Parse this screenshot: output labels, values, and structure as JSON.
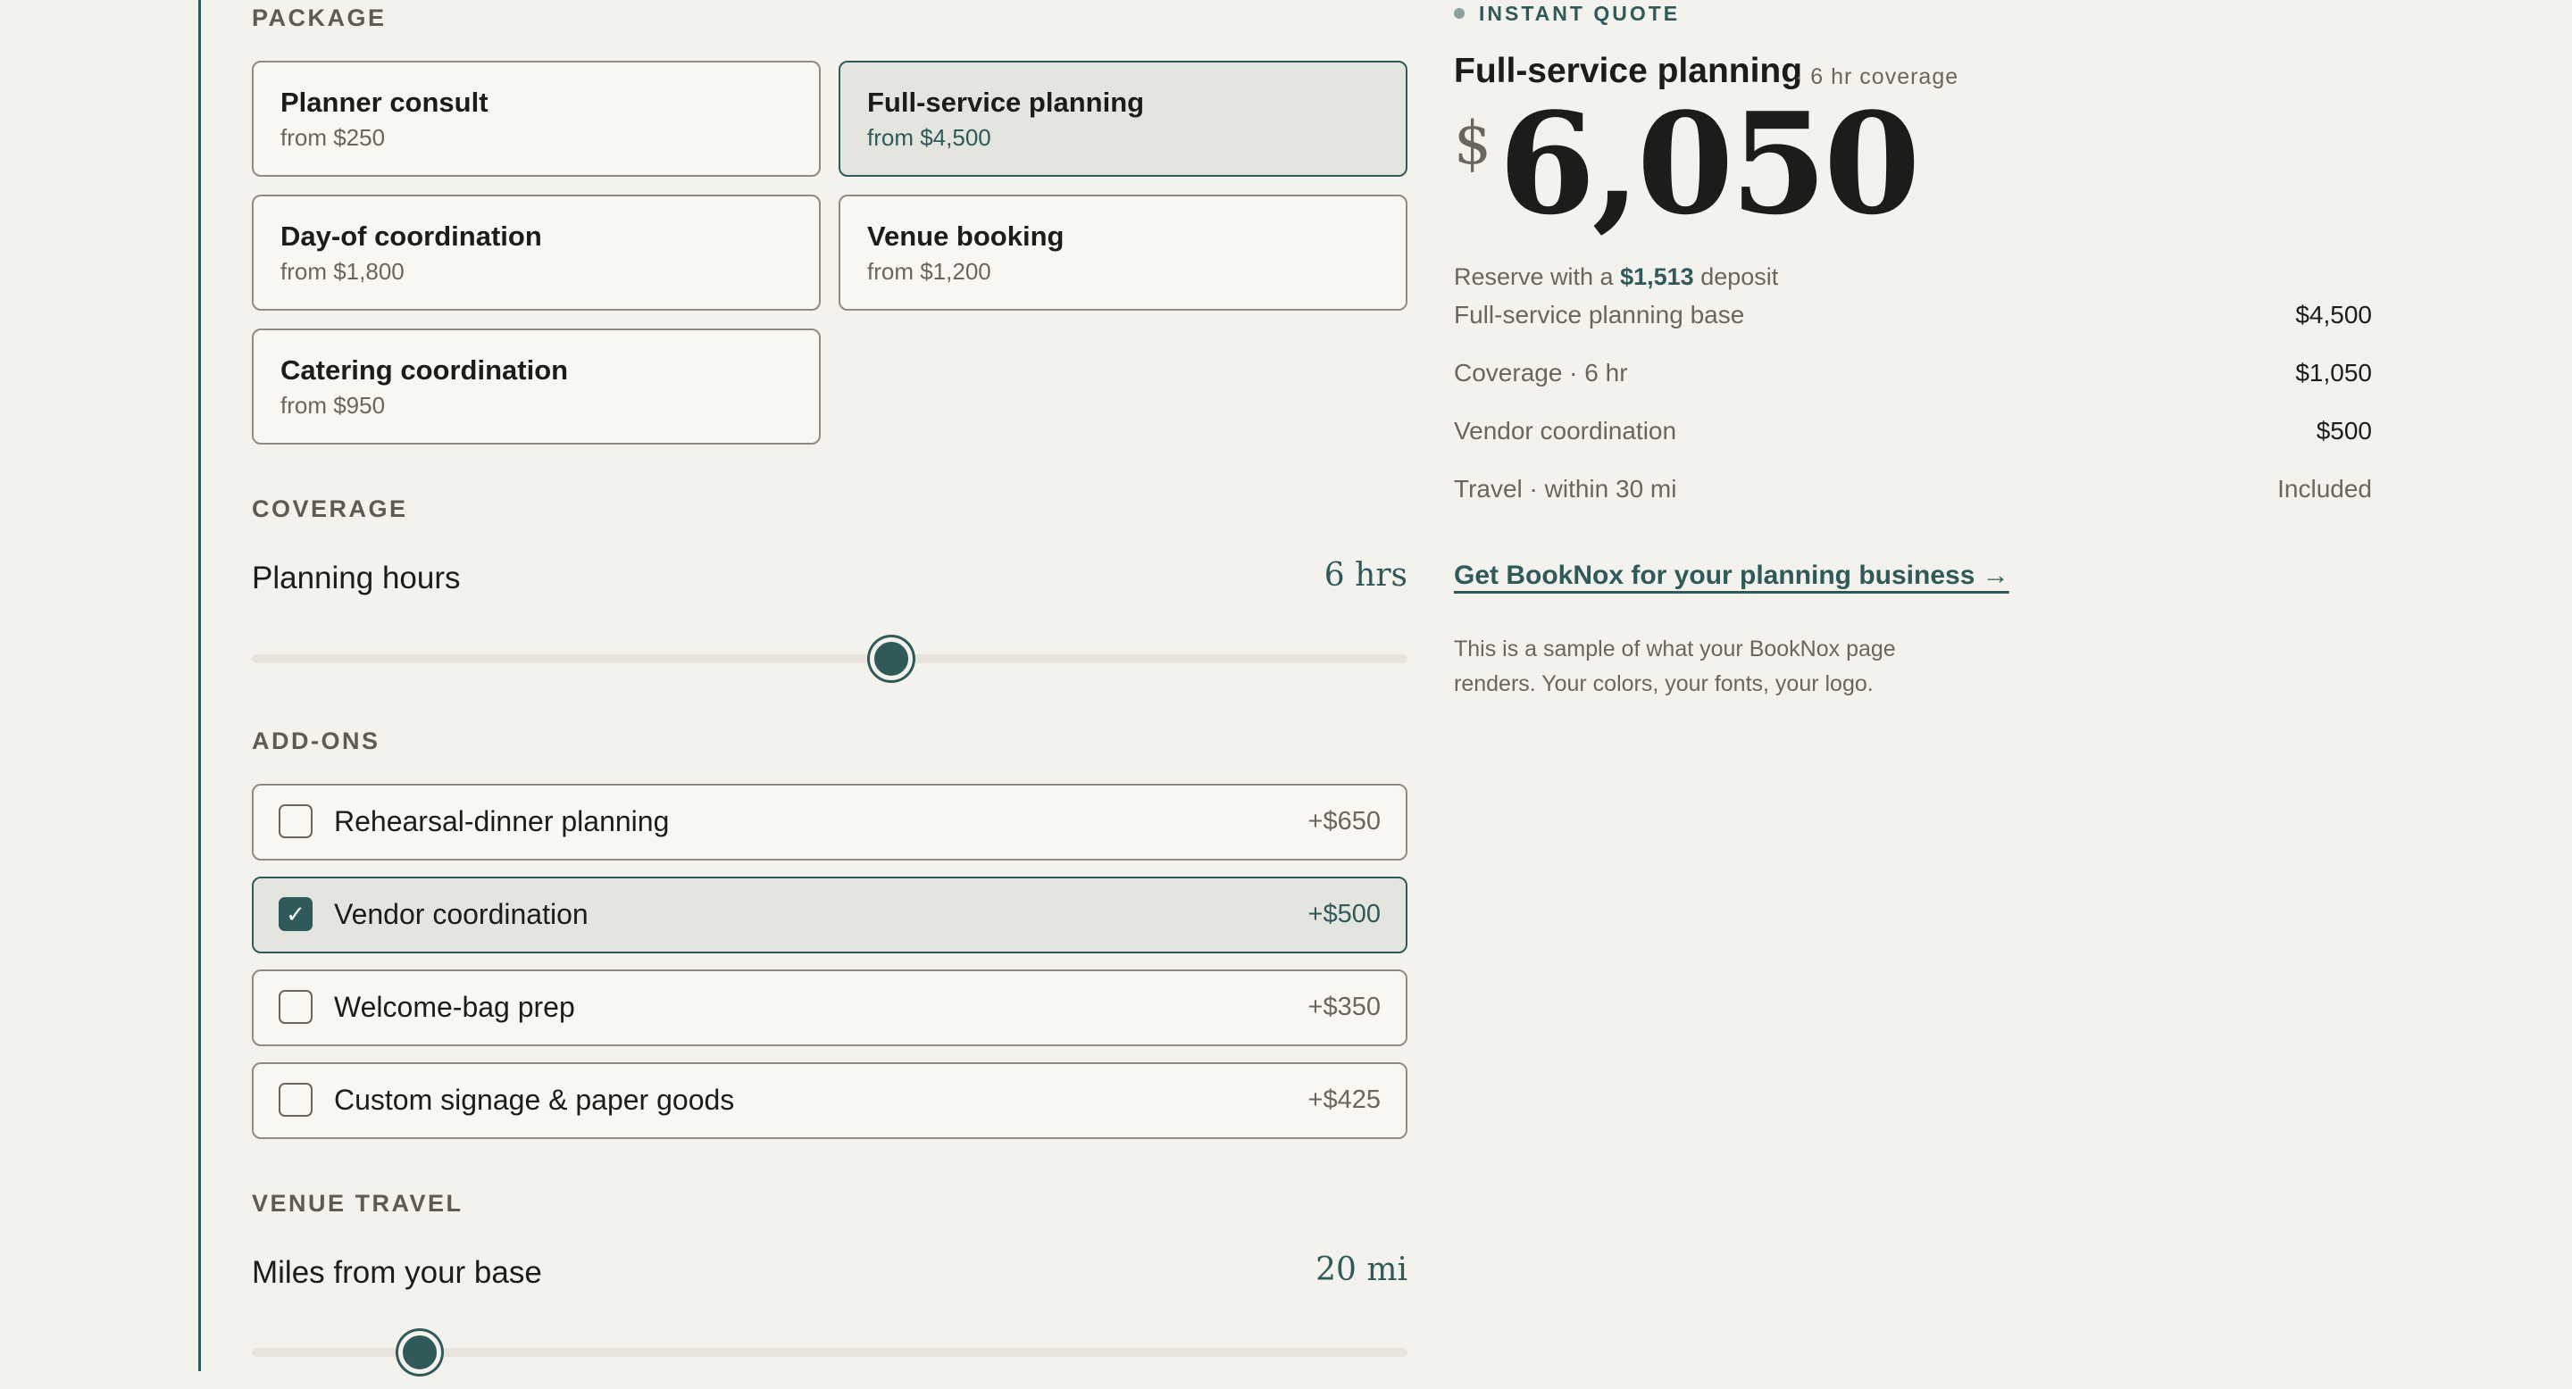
{
  "colors": {
    "accent": "#2f5a59",
    "background": "#f4f2ed",
    "card": "#f9f7f2",
    "selected_card": "#e5e5df"
  },
  "package": {
    "label": "PACKAGE",
    "options": [
      {
        "name": "Planner consult",
        "price": "from $250",
        "selected": false
      },
      {
        "name": "Full-service planning",
        "price": "from $4,500",
        "selected": true
      },
      {
        "name": "Day-of coordination",
        "price": "from $1,800",
        "selected": false
      },
      {
        "name": "Venue booking",
        "price": "from $1,200",
        "selected": false
      },
      {
        "name": "Catering coordination",
        "price": "from $950",
        "selected": false
      }
    ]
  },
  "coverage": {
    "label": "COVERAGE",
    "title": "Planning hours",
    "value": "6 hrs",
    "slider_fraction": 0.553
  },
  "addons": {
    "label": "ADD-ONS",
    "items": [
      {
        "name": "Rehearsal-dinner planning",
        "price": "+$650",
        "checked": false
      },
      {
        "name": "Vendor coordination",
        "price": "+$500",
        "checked": true
      },
      {
        "name": "Welcome-bag prep",
        "price": "+$350",
        "checked": false
      },
      {
        "name": "Custom signage & paper goods",
        "price": "+$425",
        "checked": false
      }
    ],
    "check_glyph": "✓"
  },
  "travel": {
    "label": "VENUE TRAVEL",
    "title": "Miles from your base",
    "value": "20 mi",
    "slider_fraction": 0.145
  },
  "quote": {
    "eyebrow": "INSTANT QUOTE",
    "title": "Full-service planning",
    "coverage_note": "· 6 hr coverage",
    "currency": "$",
    "total": "6,050",
    "deposit_prefix": "Reserve with a",
    "deposit_amount": "$1,513",
    "deposit_suffix": "deposit",
    "lines": [
      {
        "label": "Full-service planning base",
        "value": "$4,500"
      },
      {
        "label": "Coverage · 6 hr",
        "value": "$1,050"
      },
      {
        "label": "Vendor coordination",
        "value": "$500"
      },
      {
        "label": "Travel · within 30 mi",
        "value": "Included"
      }
    ],
    "cta": "Get BookNox for your planning business →",
    "note": "This is a sample of what your BookNox page renders. Your colors, your fonts, your logo."
  }
}
